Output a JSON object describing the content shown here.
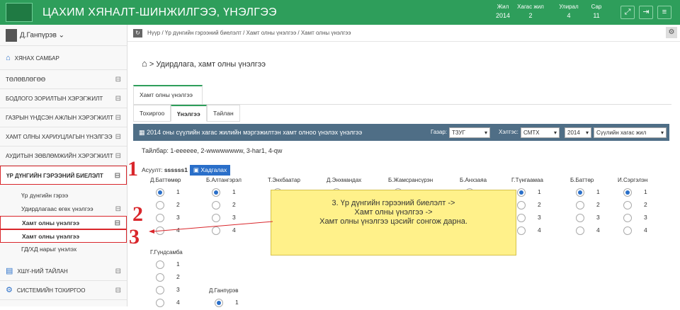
{
  "header": {
    "title": "ЦАХИМ ХЯНАЛТ-ШИНЖИЛГЭЭ, ҮНЭЛГЭЭ",
    "periods": [
      {
        "label": "Жил",
        "value": "2014"
      },
      {
        "label": "Хагас жил",
        "value": "2"
      },
      {
        "label": "Улирал",
        "value": "4"
      },
      {
        "label": "Сар",
        "value": "11"
      }
    ]
  },
  "user": "Д.Ганпүрэв",
  "sidebar": [
    "ХЯНАХ САМБАР",
    "ТӨЛӨВЛӨГӨӨ",
    "БОДЛОГО ЗОРИЛТЫН ХЭРЭГЖИЛТ",
    "ГАЗРЫН ҮНДСЭН АЖЛЫН ХЭРЭГЖИЛТ",
    "ХАМТ ОЛНЫ ХАРИУЦЛАГЫН ҮНЭЛГЭЭ",
    "АУДИТЫН ЗӨВЛӨМЖИЙН ХЭРЭГЖИЛТ",
    "ҮР ДҮНГИЙН ГЭРЭЭНИЙ БИЕЛЭЛТ"
  ],
  "subitems": [
    "Үр дүнгийн гэрээ",
    "Удирдлагаас өгөх үнэлгээ",
    "Хамт олны үнэлгээ",
    "Хамт олны үнэлгээ",
    "ГД/ХД нарыг үнэлэх"
  ],
  "sidebar_bottom": [
    "ХШҮ-НИЙ ТАЙЛАН",
    "СИСТЕМИЙН ТОХИРГОО"
  ],
  "numbers": [
    "1",
    "2",
    "3"
  ],
  "breadcrumb": "Нүүр  /  Үр дүнгийн гэрээний биелэлт  /  Хамт олны үнэлгээ  /  Хамт олны үнэлгээ",
  "page_heading": "> Удирдлага, хамт олны үнэлгээ",
  "tab_main": "Хамт олны үнэлгээ",
  "tabs": [
    "Тохиргоо",
    "Үнэлгээ",
    "Тайлан"
  ],
  "panel": {
    "title": "2014 оны сүүлийн хагас жилийн мэргэжилтэн хамт олноо үнэлэх үнэлгээ",
    "org_label": "Газар:",
    "org_value": "ТЗУГ",
    "dept_label": "Хэлтэс:",
    "dept_value": "СМТХ",
    "year_value": "2014",
    "half_value": "Сүүлийн хагас жил"
  },
  "note": "Тайлбар: 1-еееееe, 2-wwwwwwww, 3-har1, 4-qw",
  "question_label": "Асуулт:",
  "question_value": "ssssss1",
  "save_label": "Хадгалах",
  "people": [
    "Д.Баттөмөр",
    "Б.Алтангэрэл",
    "Т.Энхбаатар",
    "Д.Энхмандах",
    "Б.Жамсрансүрэн",
    "Б.Анхзаяа",
    "Г.Түнгаамаа",
    "Б.Баттөр",
    "И.Сэргэлэн"
  ],
  "people_row2": [
    "Г.Гүндсамба",
    "Д.Ганпүрэв"
  ],
  "options": [
    "1",
    "2",
    "3",
    "4"
  ],
  "callout": [
    "3. Үр дүнгийн гэрээний биелэлт ->",
    "Хамт олны үнэлгээ ->",
    "Хамт олны үнэлгээ цэсийг сонгож дарна."
  ]
}
